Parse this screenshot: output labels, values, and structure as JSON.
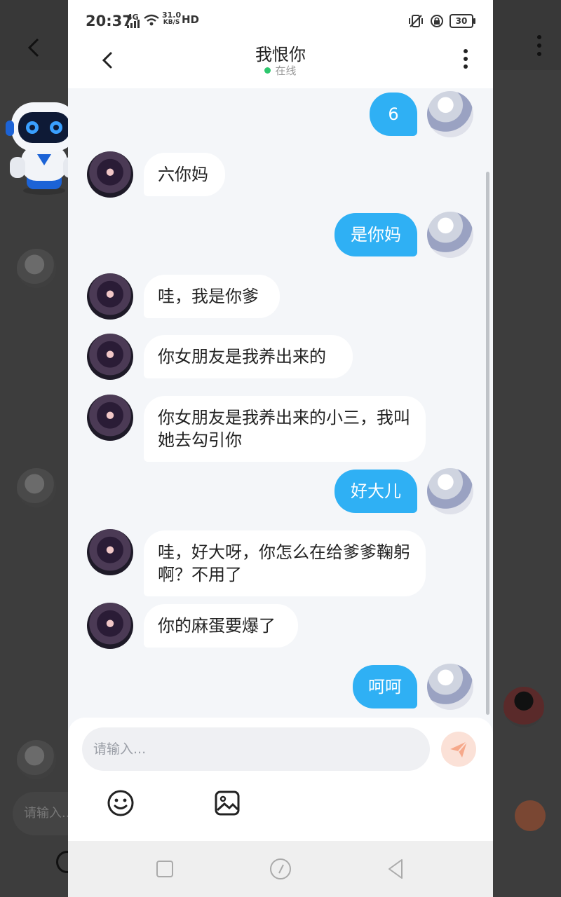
{
  "status_bar": {
    "time": "20:37",
    "network": "4G",
    "speed_value": "31.0",
    "speed_unit": "KB/S",
    "hd": "HD",
    "battery": "30"
  },
  "header": {
    "title": "我恨你",
    "status": "在线"
  },
  "messages": [
    {
      "side": "out",
      "text": "6"
    },
    {
      "side": "in",
      "text": "六你妈"
    },
    {
      "side": "out",
      "text": "是你妈"
    },
    {
      "side": "in",
      "text": "哇，我是你爹"
    },
    {
      "side": "in",
      "text": "你女朋友是我养出来的"
    },
    {
      "side": "in",
      "text": "你女朋友是我养出来的小三，我叫她去勾引你"
    },
    {
      "side": "out",
      "text": "好大儿"
    },
    {
      "side": "in",
      "text": "哇，好大呀，你怎么在给爹爹鞠躬啊？不用了"
    },
    {
      "side": "in",
      "text": "你的麻蛋要爆了"
    },
    {
      "side": "out",
      "text": "呵呵"
    }
  ],
  "composer": {
    "placeholder": "请输入..."
  },
  "background": {
    "input_placeholder": "请输入..."
  },
  "icons": {
    "back": "chevron-left-icon",
    "menu": "more-vertical-icon",
    "send": "send-icon",
    "emoji": "emoji-icon",
    "image": "image-icon",
    "nav_square": "recent-apps-icon",
    "nav_home": "home-icon",
    "nav_back": "nav-back-icon"
  },
  "colors": {
    "out_bubble": "#2fb0f4",
    "in_bubble": "#ffffff",
    "online_dot": "#2dc76d",
    "send_button": "#fbe1d7"
  }
}
